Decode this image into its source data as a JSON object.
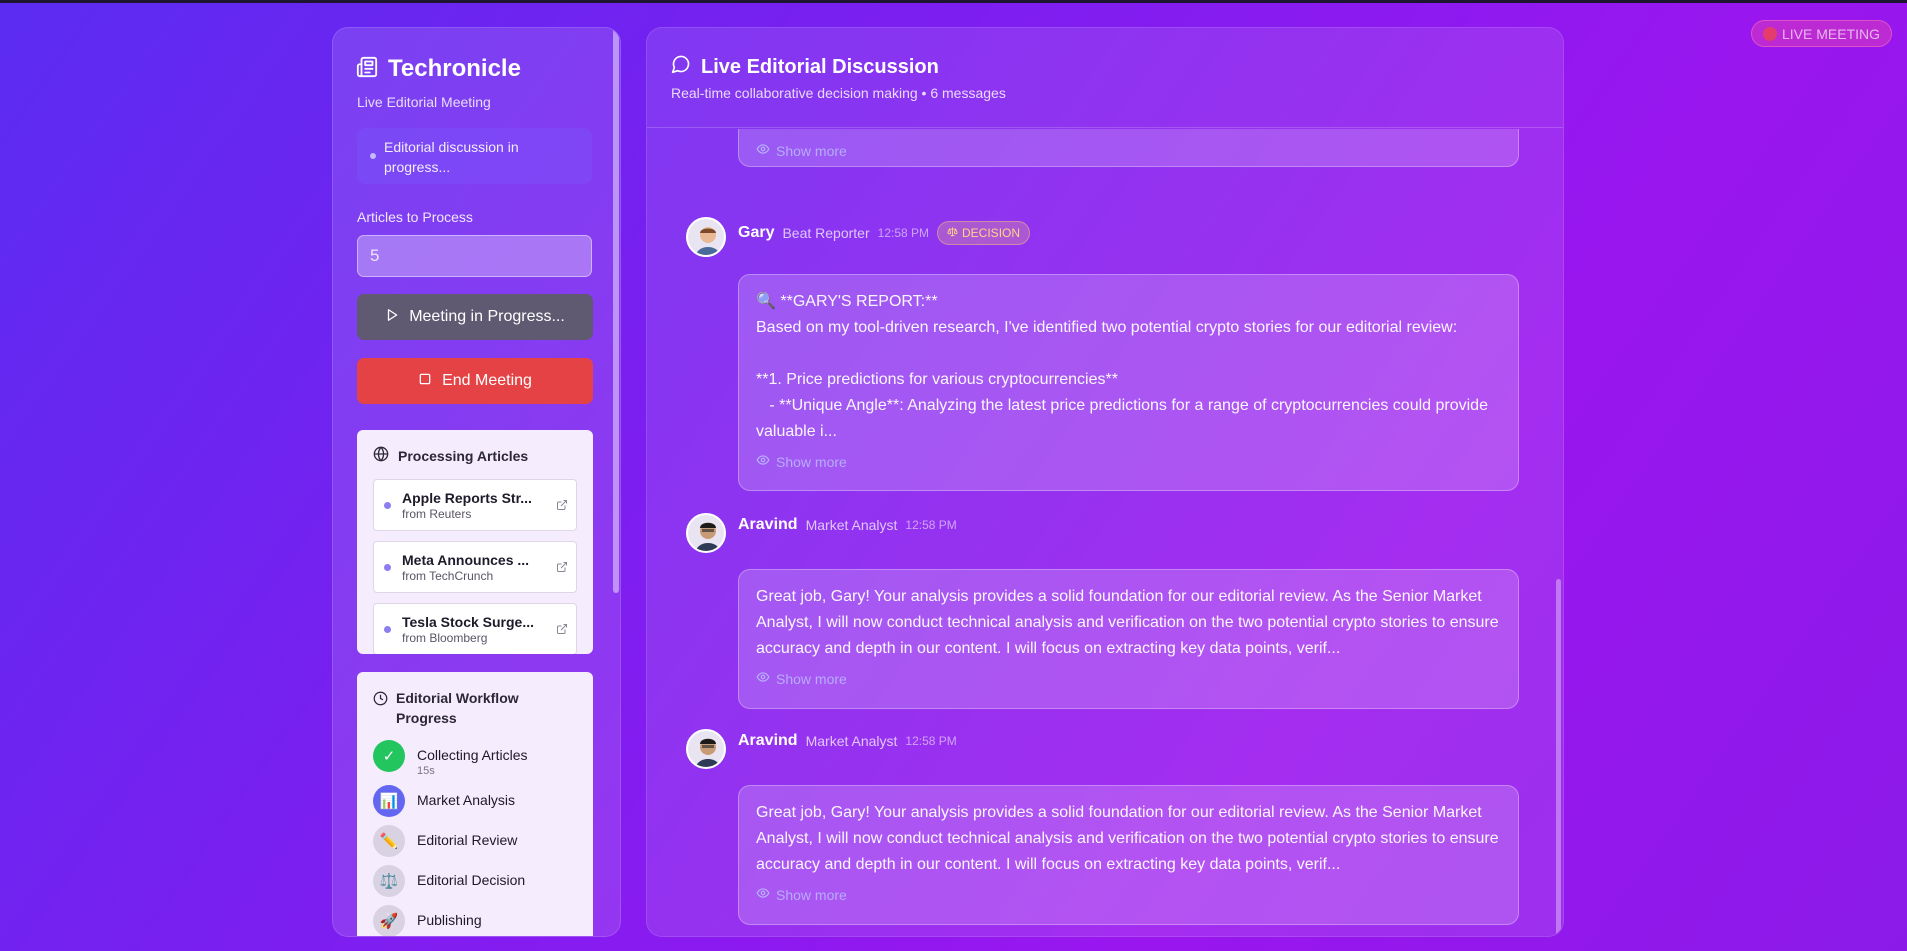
{
  "brand": {
    "title": "Techronicle",
    "subtitle": "Live Editorial Meeting",
    "status": "Editorial discussion in progress..."
  },
  "controls": {
    "articles_label": "Articles to Process",
    "articles_value": "5",
    "progress_button": "Meeting in Progress...",
    "end_button": "End Meeting"
  },
  "processing": {
    "title": "Processing Articles",
    "articles": [
      {
        "title": "Apple Reports Str...",
        "source": "from Reuters"
      },
      {
        "title": "Meta Announces ...",
        "source": "from TechCrunch"
      },
      {
        "title": "Tesla Stock Surge...",
        "source": "from Bloomberg"
      }
    ]
  },
  "workflow": {
    "title": "Editorial Workflow Progress",
    "steps": [
      {
        "label": "Collecting Articles",
        "time": "15s",
        "icon": "check-icon",
        "state": "done"
      },
      {
        "label": "Market Analysis",
        "time": "",
        "icon": "chart-icon",
        "state": "active"
      },
      {
        "label": "Editorial Review",
        "time": "",
        "icon": "pencil-icon",
        "state": "pending"
      },
      {
        "label": "Editorial Decision",
        "time": "",
        "icon": "scales-icon",
        "state": "pending"
      },
      {
        "label": "Publishing",
        "time": "",
        "icon": "rocket-icon",
        "state": "pending"
      }
    ]
  },
  "chat": {
    "title": "Live Editorial Discussion",
    "subtitle": "Real-time collaborative decision making • 6 messages",
    "show_more": "Show more",
    "messages": [
      {
        "name": "Gary",
        "role": "Beat Reporter",
        "time": "12:58 PM",
        "badge": "DECISION",
        "lines": [
          "🔍 **GARY'S REPORT:**",
          "Based on my tool-driven research, I've identified two potential crypto stories for our editorial review:",
          "",
          "**1. Price predictions for various cryptocurrencies**",
          "   - **Unique Angle**: Analyzing the latest price predictions for a range of cryptocurrencies could provide valuable i..."
        ]
      },
      {
        "name": "Aravind",
        "role": "Market Analyst",
        "time": "12:58 PM",
        "text": "Great job, Gary! Your analysis provides a solid foundation for our editorial review. As the Senior Market Analyst, I will now conduct technical analysis and verification on the two potential crypto stories to ensure accuracy and depth in our content. I will focus on extracting key data points, verif..."
      },
      {
        "name": "Aravind",
        "role": "Market Analyst",
        "time": "12:58 PM",
        "text": "Great job, Gary! Your analysis provides a solid foundation for our editorial review. As the Senior Market Analyst, I will now conduct technical analysis and verification on the two potential crypto stories to ensure accuracy and depth in our content. I will focus on extracting key data points, verif..."
      }
    ]
  },
  "live_badge": "LIVE MEETING",
  "colors": {
    "end_button": "#e54245",
    "progress_button": "#5f5a72",
    "check_green": "#22c55e",
    "active_blue": "#6366f1",
    "badge_amber": "#ffd38a"
  }
}
